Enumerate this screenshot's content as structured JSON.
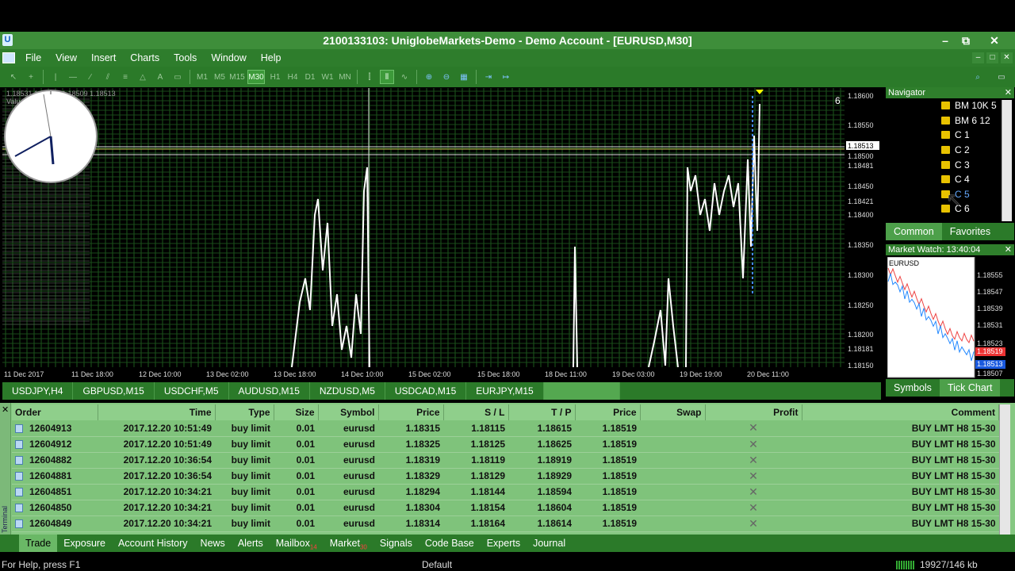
{
  "window": {
    "title": "2100133103: UniglobeMarkets-Demo - Demo Account - [EURUSD,M30]",
    "app_icon": "U"
  },
  "menu": [
    "File",
    "View",
    "Insert",
    "Charts",
    "Tools",
    "Window",
    "Help"
  ],
  "toolbar": {
    "timeframes": [
      "M1",
      "M5",
      "M15",
      "M30",
      "H1",
      "H4",
      "D1",
      "W1",
      "MN"
    ],
    "active_timeframe": "M30"
  },
  "chart": {
    "info_line": "1.18531 1.18579 1.18509 1.18513",
    "volume_label": "Value: 500",
    "chart_number": "6",
    "price_ticks": [
      "1.18600",
      "1.18550",
      "1.18513",
      "1.18500",
      "1.18481",
      "1.18450",
      "1.18421",
      "1.18400",
      "1.18350",
      "1.18300",
      "1.18250",
      "1.18200",
      "1.18181",
      "1.18150"
    ],
    "time_ticks": [
      "11 Dec 2017",
      "11 Dec 18:00",
      "12 Dec 10:00",
      "13 Dec 02:00",
      "13 Dec 18:00",
      "14 Dec 10:00",
      "15 Dec 02:00",
      "15 Dec 18:00",
      "18 Dec 11:00",
      "19 Dec 03:00",
      "19 Dec 19:00",
      "20 Dec 11:00"
    ]
  },
  "symbol_tabs": [
    "USDJPY,H4",
    "GBPUSD,M15",
    "USDCHF,M5",
    "AUDUSD,M15",
    "NZDUSD,M5",
    "USDCAD,M15",
    "EURJPY,M15"
  ],
  "navigator": {
    "title": "Navigator",
    "items": [
      "BM 10K 5",
      "BM 6 12",
      "C 1",
      "C 2",
      "C 3",
      "C 4",
      "C 5",
      "C 6"
    ],
    "tabs": [
      "Common",
      "Favorites"
    ]
  },
  "market_watch": {
    "title": "Market Watch: 13:40:04",
    "symbol": "EURUSD",
    "prices": [
      "1.18555",
      "1.18547",
      "1.18539",
      "1.18531",
      "1.18523",
      "1.18519",
      "1.18513",
      "1.18507"
    ],
    "tabs": [
      "Symbols",
      "Tick Chart"
    ]
  },
  "terminal": {
    "side_label": "Terminal",
    "columns": [
      "Order",
      "Time",
      "Type",
      "Size",
      "Symbol",
      "Price",
      "S / L",
      "T / P",
      "Price",
      "Swap",
      "Profit",
      "Comment"
    ],
    "rows": [
      [
        "12604913",
        "2017.12.20 10:51:49",
        "buy limit",
        "0.01",
        "eurusd",
        "1.18315",
        "1.18115",
        "1.18615",
        "1.18519",
        "",
        "",
        "BUY LMT H8 15-30"
      ],
      [
        "12604912",
        "2017.12.20 10:51:49",
        "buy limit",
        "0.01",
        "eurusd",
        "1.18325",
        "1.18125",
        "1.18625",
        "1.18519",
        "",
        "",
        "BUY LMT H8 15-30"
      ],
      [
        "12604882",
        "2017.12.20 10:36:54",
        "buy limit",
        "0.01",
        "eurusd",
        "1.18319",
        "1.18119",
        "1.18919",
        "1.18519",
        "",
        "",
        "BUY LMT H8 15-30"
      ],
      [
        "12604881",
        "2017.12.20 10:36:54",
        "buy limit",
        "0.01",
        "eurusd",
        "1.18329",
        "1.18129",
        "1.18929",
        "1.18519",
        "",
        "",
        "BUY LMT H8 15-30"
      ],
      [
        "12604851",
        "2017.12.20 10:34:21",
        "buy limit",
        "0.01",
        "eurusd",
        "1.18294",
        "1.18144",
        "1.18594",
        "1.18519",
        "",
        "",
        "BUY LMT H8 15-30"
      ],
      [
        "12604850",
        "2017.12.20 10:34:21",
        "buy limit",
        "0.01",
        "eurusd",
        "1.18304",
        "1.18154",
        "1.18604",
        "1.18519",
        "",
        "",
        "BUY LMT H8 15-30"
      ],
      [
        "12604849",
        "2017.12.20 10:34:21",
        "buy limit",
        "0.01",
        "eurusd",
        "1.18314",
        "1.18164",
        "1.18614",
        "1.18519",
        "",
        "",
        "BUY LMT H8 15-30"
      ]
    ],
    "tabs": [
      {
        "label": "Trade",
        "badge": ""
      },
      {
        "label": "Exposure",
        "badge": ""
      },
      {
        "label": "Account History",
        "badge": ""
      },
      {
        "label": "News",
        "badge": ""
      },
      {
        "label": "Alerts",
        "badge": ""
      },
      {
        "label": "Mailbox",
        "badge": "14"
      },
      {
        "label": "Market",
        "badge": "30"
      },
      {
        "label": "Signals",
        "badge": ""
      },
      {
        "label": "Code Base",
        "badge": ""
      },
      {
        "label": "Experts",
        "badge": ""
      },
      {
        "label": "Journal",
        "badge": ""
      }
    ]
  },
  "status": {
    "help": "For Help, press F1",
    "profile": "Default",
    "traffic": "19927/146 kb"
  }
}
